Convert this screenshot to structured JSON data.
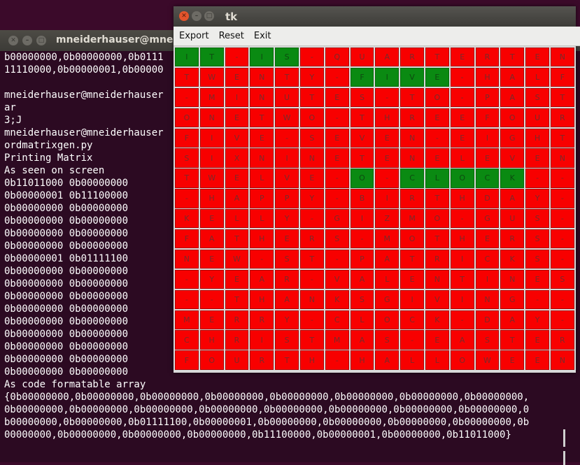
{
  "terminal": {
    "title": "mneiderhauser@mneid",
    "lines": [
      "b00000000,0b00000000,0b0111",
      "11110000,0b00000001,0b00000",
      "",
      "mneiderhauser@mneiderhauser",
      "ar",
      "\u001b3;J",
      "mneiderhauser@mneiderhauser",
      "ordmatrixgen.py",
      "Printing Matrix",
      "As seen on screen",
      "0b11011000 0b00000000",
      "0b00000001 0b11100000",
      "0b00000000 0b00000000",
      "0b00000000 0b00000000",
      "0b00000000 0b00000000",
      "0b00000000 0b00000000",
      "0b00000001 0b01111100",
      "0b00000000 0b00000000",
      "0b00000000 0b00000000",
      "0b00000000 0b00000000",
      "0b00000000 0b00000000",
      "0b00000000 0b00000000",
      "0b00000000 0b00000000",
      "0b00000000 0b00000000",
      "0b00000000 0b00000000",
      "0b00000000 0b00000000",
      "As code formatable array",
      "{0b00000000,0b00000000,0b00000000,0b00000000,0b00000000,0b00000000,0b00000000,0b00000000,",
      "0b00000000,0b00000000,0b00000000,0b00000000,0b00000000,0b00000000,0b00000000,0b00000000,0",
      "b00000000,0b00000000,0b01111100,0b00000001,0b00000000,0b00000000,0b00000000,0b00000000,0b",
      "00000000,0b00000000,0b00000000,0b00000000,0b11100000,0b00000001,0b00000000,0b11011000}"
    ]
  },
  "tk": {
    "title": "tk",
    "menu": [
      "Export",
      "Reset",
      "Exit"
    ],
    "colors": {
      "off": "#f80000",
      "on": "#0a8a12"
    },
    "grid": [
      "IT-IS-QUARTERTEN",
      "TWENTY-FIVE-HALF",
      "-MINUTES-TO-PAST",
      "ONETWO-THREEFOUR",
      "FIVE-SEVEN-EIGHT",
      "SIXNINETENELEVEN",
      "TWELVE-O-CLOCK--",
      "-HAPPY-BIRTHDAY",
      "KELLY-GIZMO-GUS-",
      "FATHERS-MOTHERS-",
      "NEW-ST-PATRICKS-",
      "-YEAR-VALENTINES",
      "--THANKSGIVING--",
      "MERRY-CLOCK-DAY-",
      "CHRISTMAS-EASTER",
      "FOURTH-HALLOWEEN"
    ],
    "active": [
      [
        0,
        0
      ],
      [
        0,
        1
      ],
      [
        0,
        3
      ],
      [
        0,
        4
      ],
      [
        1,
        7
      ],
      [
        1,
        8
      ],
      [
        1,
        9
      ],
      [
        1,
        10
      ],
      [
        6,
        7
      ],
      [
        6,
        9
      ],
      [
        6,
        10
      ],
      [
        6,
        11
      ],
      [
        6,
        12
      ],
      [
        6,
        13
      ]
    ]
  }
}
